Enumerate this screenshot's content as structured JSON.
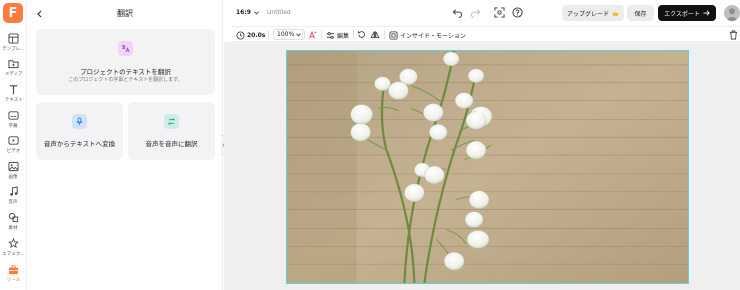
{
  "logo": {
    "letter": "F"
  },
  "sidebar": {
    "items": [
      {
        "label": "テンプレ...",
        "icon": "template-icon"
      },
      {
        "label": "メディア",
        "icon": "media-icon"
      },
      {
        "label": "テキスト",
        "icon": "text-icon"
      },
      {
        "label": "字幕",
        "icon": "subtitles-icon"
      },
      {
        "label": "ビデオ",
        "icon": "video-icon"
      },
      {
        "label": "画像",
        "icon": "image-icon"
      },
      {
        "label": "音声",
        "icon": "audio-icon"
      },
      {
        "label": "素材",
        "icon": "elements-icon"
      },
      {
        "label": "エフェク...",
        "icon": "effects-icon"
      },
      {
        "label": "ツール",
        "icon": "tools-icon",
        "active": true
      }
    ]
  },
  "panel": {
    "title": "翻訳",
    "card_main": {
      "title": "プロジェクトのテキストを翻訳",
      "subtitle": "このプロジェクトの字幕とテキストを翻訳します。"
    },
    "card_speech_to_text": {
      "title": "音声からテキストへ変換"
    },
    "card_speech_to_speech": {
      "title": "音声を音声に翻訳"
    }
  },
  "topbar": {
    "aspect_ratio": "16:9",
    "project_name": "Untitled",
    "upgrade_label": "アップグレード",
    "save_label": "保存",
    "export_label": "エクスポート"
  },
  "toolbar": {
    "duration": "20.0s",
    "zoom": "100%",
    "edit_label": "編集",
    "animation_label": "インサイド・モーション"
  },
  "colors": {
    "brand": "#ff7a3d",
    "selection": "#5fd3d3",
    "export_bg": "#111111"
  }
}
